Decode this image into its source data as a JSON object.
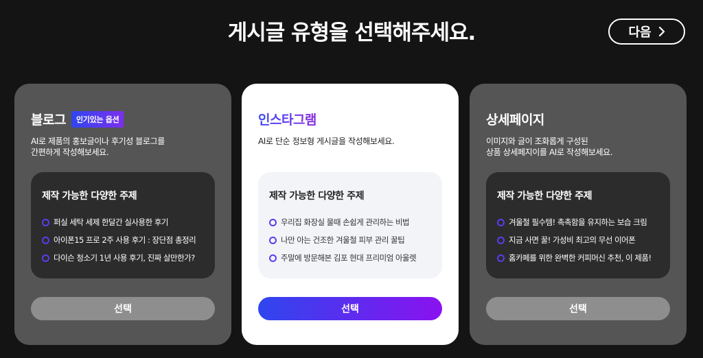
{
  "header": {
    "title": "게시글 유형을 선택해주세요.",
    "next_label": "다음",
    "next_icon": "chevron-right-icon"
  },
  "colors": {
    "background": "#141414",
    "card_dark": "#555555",
    "card_active": "#ffffff",
    "accent_start": "#2f46ee",
    "accent_end": "#8a12f0",
    "bullet": "#5b3cf0"
  },
  "cards": [
    {
      "title": "블로그",
      "badge": "인기있는 옵션",
      "description": "AI로 제품의 홍보글이나 후기성 블로그를\n간편하게 작성해보세요.",
      "topics_title": "제작 가능한 다양한 주제",
      "topics": [
        "퍼실 세탁 세제 한달간 실사용한 후기",
        "아이폰15 프로 2주 사용 후기 : 장단점 총정리",
        "다이슨 청소기 1년 사용 후기, 진짜 살만한가?"
      ],
      "select_label": "선택"
    },
    {
      "title": "인스타그램",
      "description": "AI로 단순 정보형 게시글을 작성해보세요.",
      "topics_title": "제작 가능한 다양한 주제",
      "topics": [
        "우리집 화장실 물때 손쉽게 관리하는 비법",
        "나만 아는 건조한 겨울철 피부 관리 꿀팁",
        "주말에 방문해본 김포 현대 프리미엄 아울렛"
      ],
      "select_label": "선택"
    },
    {
      "title": "상세페이지",
      "description": "이미지와 글이 조화롭게 구성된\n상품 상세페지이를 AI로 작성해보세요.",
      "topics_title": "제작 가능한 다양한 주제",
      "topics": [
        "겨울철 필수템! 촉촉함을 유지하는 보습 크림",
        "지금 사면 꿀! 가성비 최고의 무선 이어폰",
        "홈카페를 위한 완벽한 커피머신 추천, 이 제품!"
      ],
      "select_label": "선택"
    }
  ]
}
